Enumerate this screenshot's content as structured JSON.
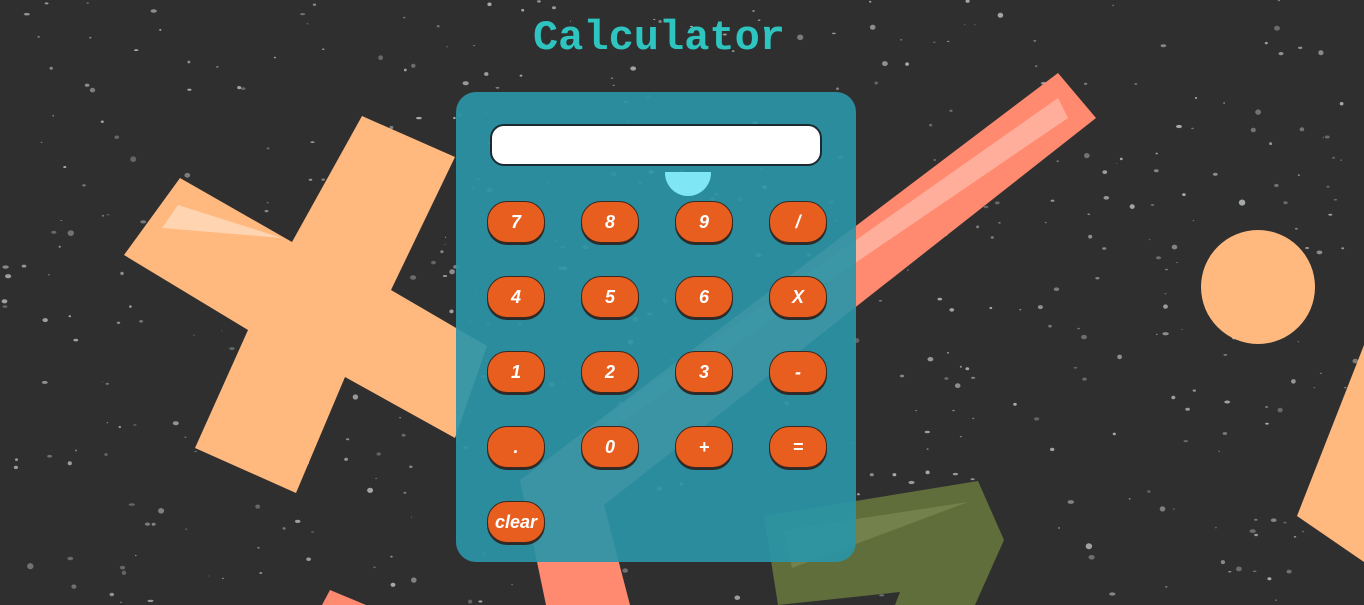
{
  "page": {
    "title": "Calculator"
  },
  "calculator": {
    "display_value": "",
    "keys": [
      {
        "label": "7",
        "name": "key-7-button"
      },
      {
        "label": "8",
        "name": "key-8-button"
      },
      {
        "label": "9",
        "name": "key-9-button"
      },
      {
        "label": "/",
        "name": "key-divide-button"
      },
      {
        "label": "4",
        "name": "key-4-button"
      },
      {
        "label": "5",
        "name": "key-5-button"
      },
      {
        "label": "6",
        "name": "key-6-button"
      },
      {
        "label": "X",
        "name": "key-multiply-button"
      },
      {
        "label": "1",
        "name": "key-1-button"
      },
      {
        "label": "2",
        "name": "key-2-button"
      },
      {
        "label": "3",
        "name": "key-3-button"
      },
      {
        "label": "-",
        "name": "key-minus-button"
      },
      {
        "label": ".",
        "name": "key-decimal-button"
      },
      {
        "label": "0",
        "name": "key-0-button"
      },
      {
        "label": "+",
        "name": "key-plus-button"
      },
      {
        "label": "=",
        "name": "key-equals-button"
      },
      {
        "label": "clear",
        "name": "clear-button"
      }
    ]
  },
  "colors": {
    "background": "#2f2f2f",
    "title": "#2ec4bf",
    "calculator_body": "#2a95a7",
    "button": "#e85e1f",
    "shape_peach": "#ffb87e",
    "shape_salmon": "#ff8a70",
    "shape_olive": "#5f6e3a"
  }
}
